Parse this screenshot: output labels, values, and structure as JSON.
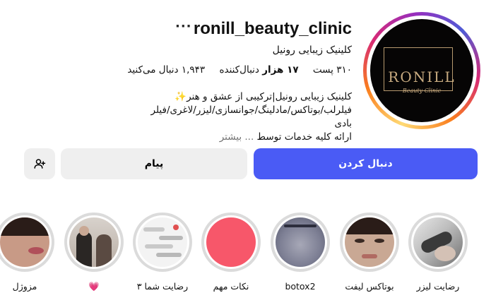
{
  "profile": {
    "username": "ronill_beauty_clinic",
    "more_glyph": "···",
    "full_name": "کلینیک زیبایی رونیل",
    "stats": {
      "posts": "۳۱۰ پست",
      "followers_count": "۱۷ هزار",
      "followers_label": "دنبال‌کننده",
      "following": "۱,۹۴۳ دنبال می‌کنید"
    },
    "bio": {
      "line1": "کلینیک زیبایی رونیل|ترکیبی از عشق و هنر✨",
      "line2": "فیلرلب/بوتاکس/مادلینگ/جوانسازی/لیزر/لاغری/فیلر بادی",
      "line3_text": "ارائه کلیه خدمات توسط",
      "line3_more": "... بیشتر"
    },
    "avatar_logo": {
      "brand": "RONILL",
      "sub": "Beauty Clinic"
    }
  },
  "actions": {
    "follow": "دنبال کردن",
    "message": "پیام",
    "suggest_icon": "add-person-icon"
  },
  "highlights": [
    {
      "label": "رضایت لیزر",
      "thumb": "laser-photo"
    },
    {
      "label": "بوتاکس لیفت",
      "thumb": "face-photo"
    },
    {
      "label": "botox2",
      "thumb": "botox-photo"
    },
    {
      "label": "نکات مهم",
      "thumb": "pink-circle"
    },
    {
      "label": "رضایت شما ۳",
      "thumb": "chat-screenshot"
    },
    {
      "label": "💗",
      "thumb": "clinic-photo"
    },
    {
      "label": "مزوژل",
      "thumb": "lips-photo"
    }
  ],
  "colors": {
    "follow_button": "#4a5bf5",
    "secondary_button": "#efefef",
    "highlight_pink": "#f7576a",
    "logo_gold": "#c8ab80"
  }
}
